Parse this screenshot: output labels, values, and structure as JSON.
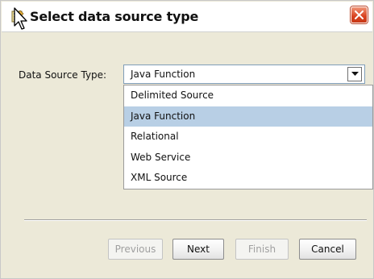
{
  "window": {
    "title": "Select data source type",
    "title_icon": "wizard-icon",
    "close_icon": "close-icon",
    "close_color": "#d8411f"
  },
  "form": {
    "data_source_label": "Data Source Type:",
    "selected_value": "Java Function",
    "dropdown_arrow_icon": "chevron-down-icon"
  },
  "dropdown": {
    "items": [
      {
        "label": "Delimited Source",
        "selected": false
      },
      {
        "label": "Java Function",
        "selected": true
      },
      {
        "label": "Relational",
        "selected": false
      },
      {
        "label": "Web Service",
        "selected": false
      },
      {
        "label": "XML Source",
        "selected": false
      }
    ],
    "highlight_color": "#b8cfe5"
  },
  "buttons": {
    "previous": {
      "label": "Previous",
      "enabled": false
    },
    "next": {
      "label": "Next",
      "enabled": true
    },
    "finish": {
      "label": "Finish",
      "enabled": false
    },
    "cancel": {
      "label": "Cancel",
      "enabled": true
    }
  }
}
